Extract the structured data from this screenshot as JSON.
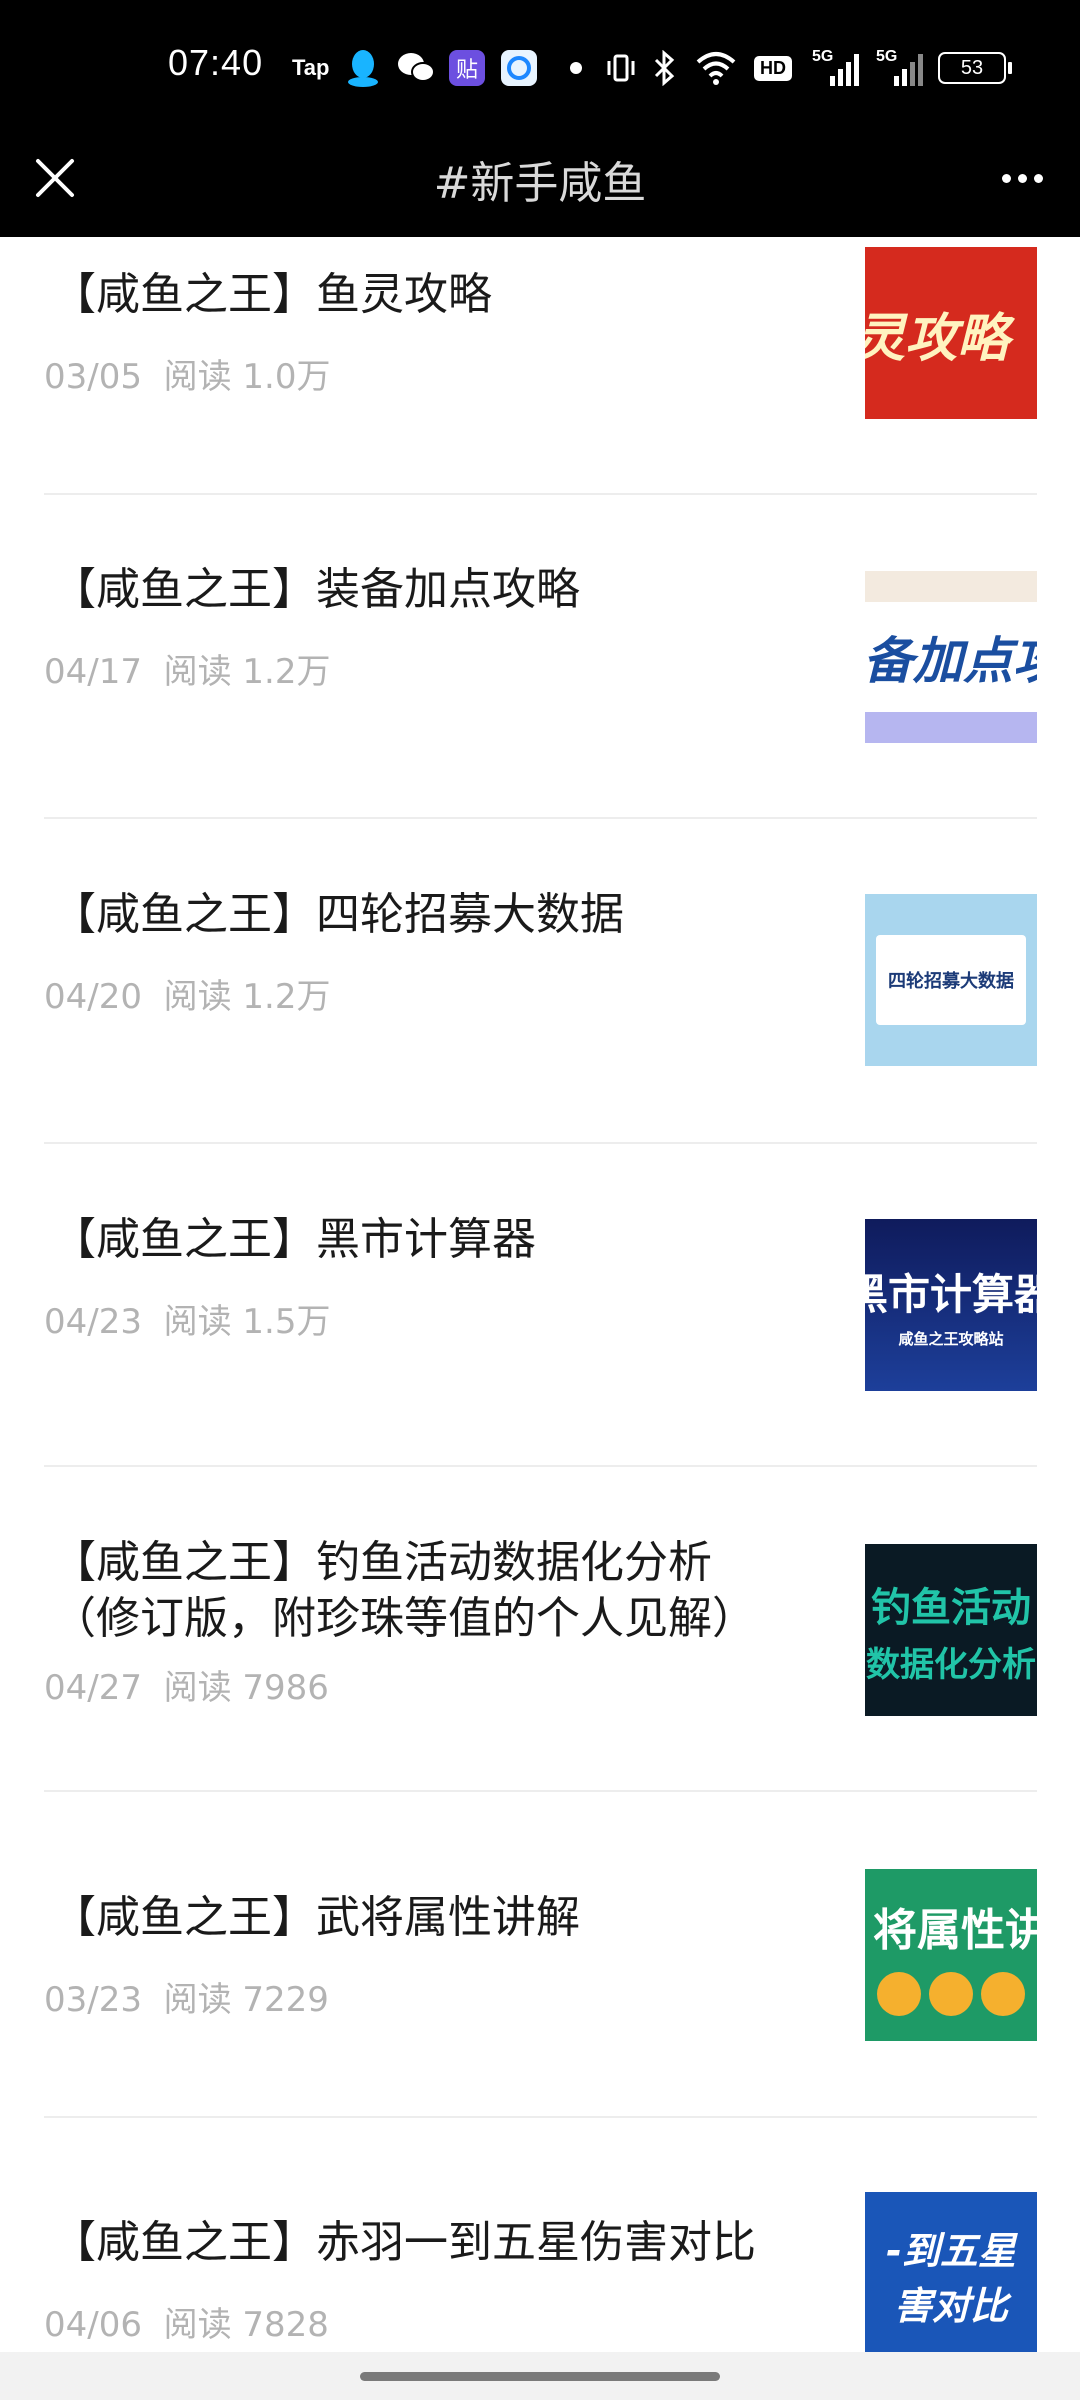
{
  "status_bar": {
    "time": "07:40",
    "icons": [
      "tap-app-icon",
      "qq-icon",
      "wechat-icon",
      "tieba-icon",
      "browser-app-icon",
      "notification-dot-icon",
      "vibrate-icon",
      "bluetooth-icon",
      "wifi-icon",
      "hd-icon",
      "signal-5g-icon",
      "signal-5g-icon"
    ],
    "tap_label": "Tap",
    "tieba_label": "贴",
    "hd_label": "HD",
    "net1_label": "5G",
    "net2_label": "5G",
    "battery": "53"
  },
  "nav": {
    "title": "#新手咸鱼",
    "left_icon": "close-icon",
    "right_icon": "more-icon"
  },
  "articles": [
    {
      "title": "【咸鱼之王】鱼灵攻略",
      "date": "03/05",
      "reads": "阅读 1.0万",
      "thumb_text": "灵攻略"
    },
    {
      "title": "【咸鱼之王】装备加点攻略",
      "date": "04/17",
      "reads": "阅读 1.2万",
      "thumb_text": "备加点攻"
    },
    {
      "title": "【咸鱼之王】四轮招募大数据",
      "date": "04/20",
      "reads": "阅读 1.2万",
      "thumb_text": "四轮招募大数据"
    },
    {
      "title": "【咸鱼之王】黑市计算器",
      "date": "04/23",
      "reads": "阅读 1.5万",
      "thumb_text": "黑市计算器",
      "thumb_sub": "咸鱼之王攻略站"
    },
    {
      "title": "【咸鱼之王】钓鱼活动数据化分析（修订版，附珍珠等值的个人见解）",
      "date": "04/27",
      "reads": "阅读 7986",
      "thumb_text": "钓鱼活动",
      "thumb_text2": "数据化分析"
    },
    {
      "title": "【咸鱼之王】武将属性讲解",
      "date": "03/23",
      "reads": "阅读 7229",
      "thumb_text": "将属性讲"
    },
    {
      "title": "【咸鱼之王】赤羽一到五星伤害对比",
      "date": "04/06",
      "reads": "阅读 7828",
      "thumb_text": "-到五星",
      "thumb_text2": "害对比"
    }
  ],
  "colors": {
    "status_bg": "#000000",
    "title_text": "#1a1a1a",
    "meta_text": "#b3b3b3",
    "divider": "#ededed"
  }
}
